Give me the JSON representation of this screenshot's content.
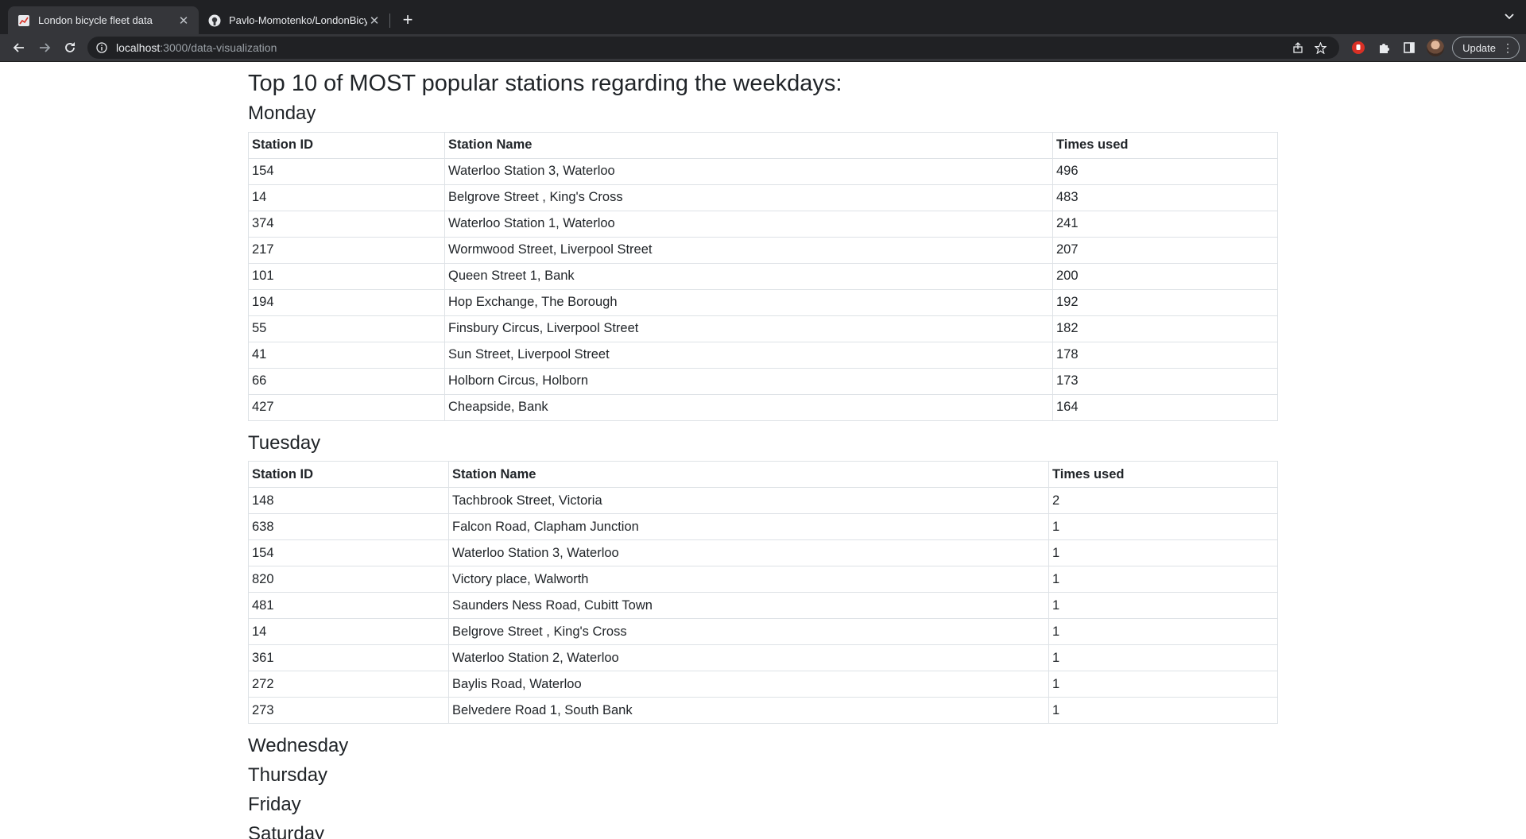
{
  "browser": {
    "tabs": [
      {
        "title": "London bicycle fleet data",
        "active": true
      },
      {
        "title": "Pavlo-Momotenko/LondonBicy",
        "active": false
      }
    ],
    "url_host": "localhost",
    "url_path": ":3000/data-visualization",
    "update_label": "Update"
  },
  "page": {
    "title": "Top 10 of MOST popular stations regarding the weekdays:",
    "columns": [
      "Station ID",
      "Station Name",
      "Times used"
    ],
    "days": [
      {
        "name": "Monday",
        "rows": [
          [
            "154",
            "Waterloo Station 3, Waterloo",
            "496"
          ],
          [
            "14",
            "Belgrove Street , King's Cross",
            "483"
          ],
          [
            "374",
            "Waterloo Station 1, Waterloo",
            "241"
          ],
          [
            "217",
            "Wormwood Street, Liverpool Street",
            "207"
          ],
          [
            "101",
            "Queen Street 1, Bank",
            "200"
          ],
          [
            "194",
            "Hop Exchange, The Borough",
            "192"
          ],
          [
            "55",
            "Finsbury Circus, Liverpool Street",
            "182"
          ],
          [
            "41",
            "Sun Street, Liverpool Street",
            "178"
          ],
          [
            "66",
            "Holborn Circus, Holborn",
            "173"
          ],
          [
            "427",
            "Cheapside, Bank",
            "164"
          ]
        ]
      },
      {
        "name": "Tuesday",
        "rows": [
          [
            "148",
            "Tachbrook Street, Victoria",
            "2"
          ],
          [
            "638",
            "Falcon Road, Clapham Junction",
            "1"
          ],
          [
            "154",
            "Waterloo Station 3, Waterloo",
            "1"
          ],
          [
            "820",
            "Victory place, Walworth",
            "1"
          ],
          [
            "481",
            "Saunders Ness Road, Cubitt Town",
            "1"
          ],
          [
            "14",
            "Belgrove Street , King's Cross",
            "1"
          ],
          [
            "361",
            "Waterloo Station 2, Waterloo",
            "1"
          ],
          [
            "272",
            "Baylis Road, Waterloo",
            "1"
          ],
          [
            "273",
            "Belvedere Road 1, South Bank",
            "1"
          ]
        ]
      }
    ],
    "empty_days": [
      "Wednesday",
      "Thursday",
      "Friday",
      "Saturday"
    ]
  }
}
